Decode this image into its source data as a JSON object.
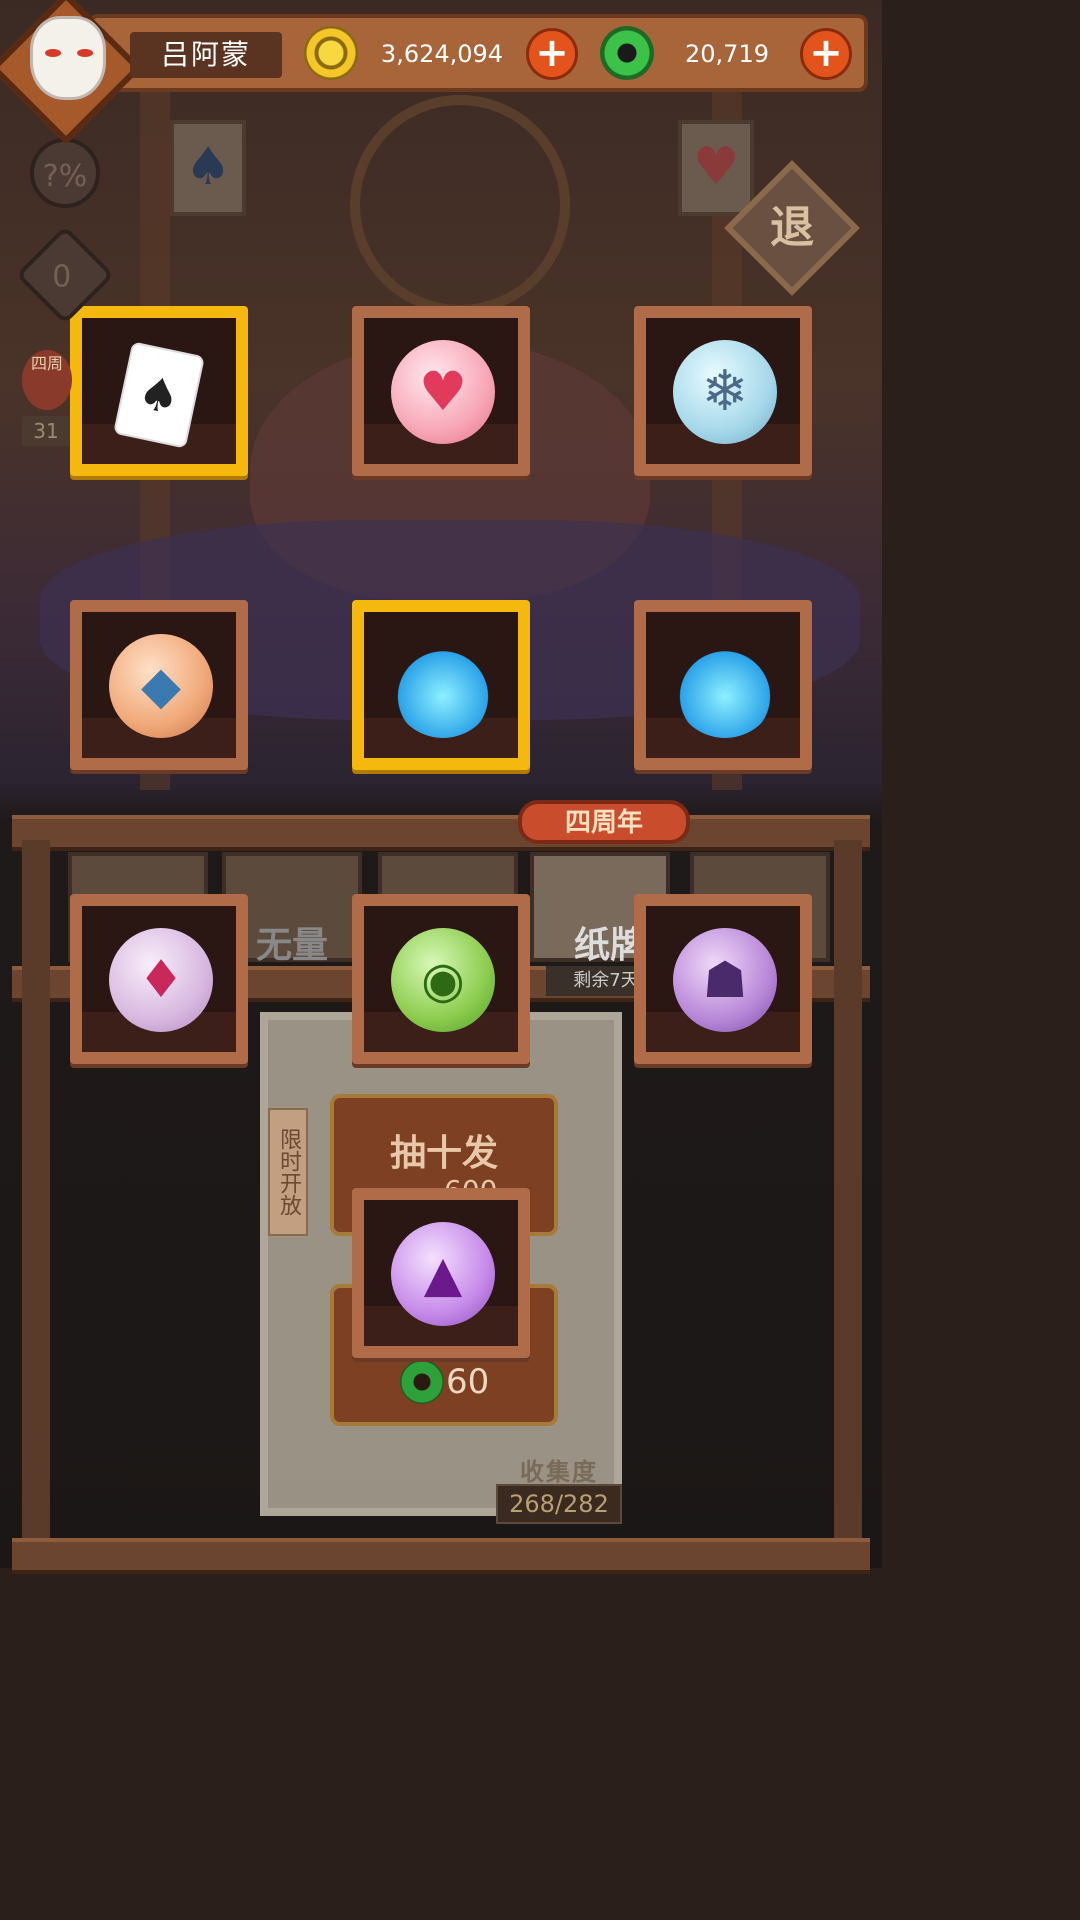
{
  "player": {
    "name": "吕阿蒙"
  },
  "currency": {
    "gold": "3,624,094",
    "jade": "20,719",
    "gold_icon": "gold-coin-icon",
    "jade_icon": "jade-ring-icon"
  },
  "side": {
    "odds_label": "?%",
    "counter": "0",
    "event_badge": "四周",
    "event_count": "31"
  },
  "exit_label": "退",
  "rewards": [
    {
      "icon": "spade-jack-card-icon",
      "highlight": true
    },
    {
      "icon": "heart-orb-icon",
      "highlight": false
    },
    {
      "icon": "snowflake-orb-icon",
      "highlight": false
    },
    {
      "icon": "gem-cushion-orb-icon",
      "highlight": false
    },
    {
      "icon": "blue-flame-icon",
      "highlight": true
    },
    {
      "icon": "blue-flame-icon",
      "highlight": false
    },
    {
      "icon": "diamond-card-orb-icon",
      "highlight": false
    },
    {
      "icon": "green-slime-orb-icon",
      "highlight": false
    },
    {
      "icon": "purple-mask-orb-icon",
      "highlight": false
    },
    {
      "icon": "purple-dust-orb-icon",
      "highlight": false
    }
  ],
  "tabs": {
    "anniversary_ribbon": "四周年",
    "tab2_label": "无量",
    "tab4_label": "纸牌",
    "remaining": "剩余7天"
  },
  "gacha": {
    "limited": "限时开放",
    "ten_draw": "抽十发",
    "ten_cost": "600",
    "single_cost": "60"
  },
  "collection": {
    "label": "收集度",
    "value": "268/282"
  }
}
